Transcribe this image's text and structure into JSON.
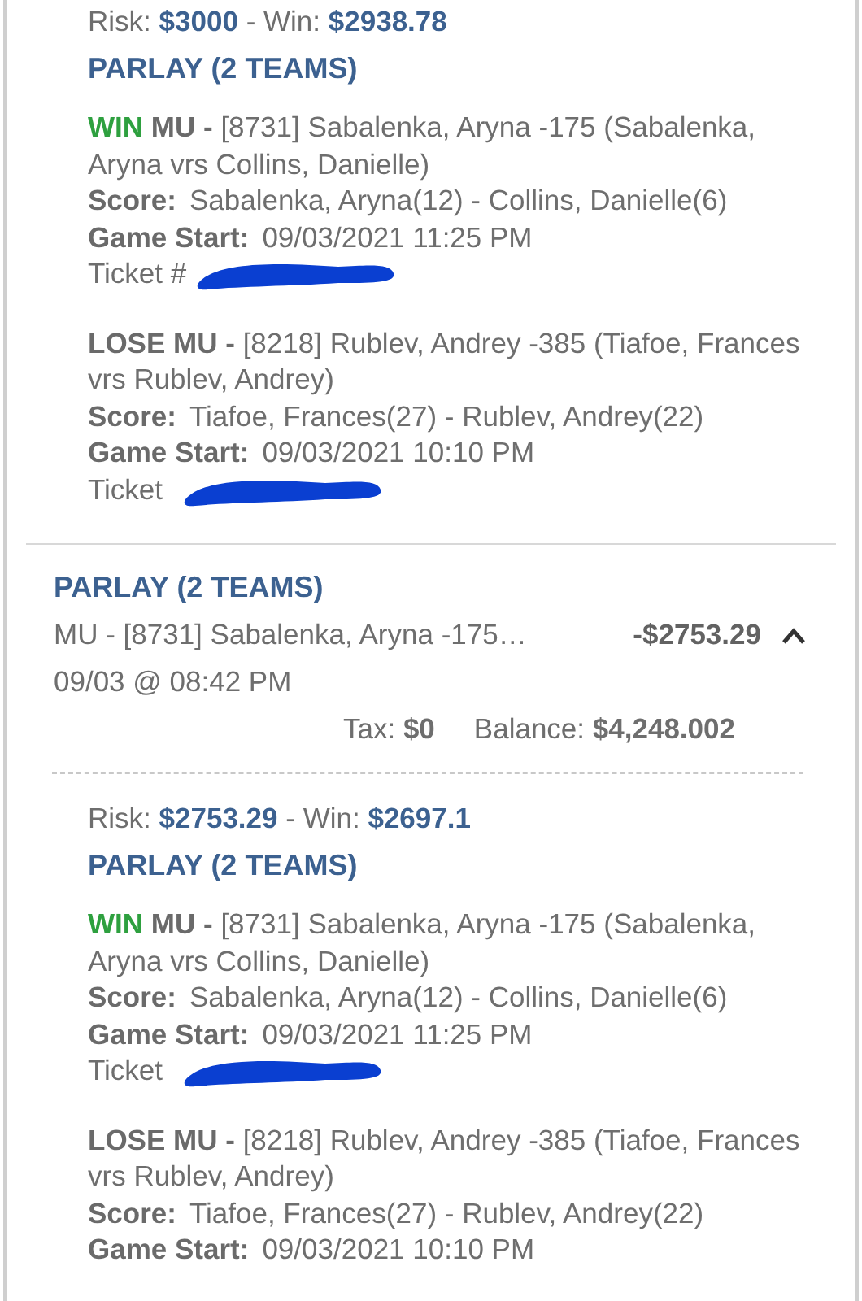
{
  "sections": [
    {
      "kind": "details",
      "risk_label": "Risk:",
      "risk": "$3000",
      "win_label": "- Win:",
      "win": "$2938.78",
      "bet_type": "PARLAY (2 TEAMS)",
      "legs": [
        {
          "kind": "win",
          "outcome": "WIN",
          "market": "MU -",
          "selection": "[8731] Sabalenka, Aryna -175 (Sabalenka, Aryna vrs Collins, Danielle)",
          "score_label": "Score:",
          "score": "Sabalenka, Aryna(12) - Collins, Danielle(6)",
          "start_label": "Game Start:",
          "start": "09/03/2021 11:25 PM",
          "ticket_label": "Ticket #"
        },
        {
          "kind": "lose",
          "outcome": "LOSE",
          "market": "MU -",
          "selection": "[8218] Rublev, Andrey -385 (Tiafoe, Frances vrs Rublev, Andrey)",
          "score_label": "Score:",
          "score": "Tiafoe, Frances(27) - Rublev, Andrey(22)",
          "start_label": "Game Start:",
          "start": "09/03/2021 10:10 PM",
          "ticket_label": "Ticket"
        }
      ]
    },
    {
      "kind": "summary",
      "bet_type": "PARLAY (2 TEAMS)",
      "selection": "MU - [8731] Sabalenka, Aryna -175…",
      "amount": "-$2753.29",
      "expanded": true,
      "placed": "09/03 @ 08:42 PM",
      "tax_label": "Tax:",
      "tax": "$0",
      "balance_label": "Balance:",
      "balance": "$4,248.002"
    },
    {
      "kind": "details",
      "risk_label": "Risk:",
      "risk": "$2753.29",
      "win_label": "- Win:",
      "win": "$2697.1",
      "bet_type": "PARLAY (2 TEAMS)",
      "legs": [
        {
          "kind": "win",
          "outcome": "WIN",
          "market": "MU -",
          "selection": "[8731] Sabalenka, Aryna -175 (Sabalenka, Aryna vrs Collins, Danielle)",
          "score_label": "Score:",
          "score": "Sabalenka, Aryna(12) - Collins, Danielle(6)",
          "start_label": "Game Start:",
          "start": "09/03/2021 11:25 PM",
          "ticket_label": "Ticket"
        },
        {
          "kind": "lose",
          "outcome": "LOSE",
          "market": "MU -",
          "selection": "[8218] Rublev, Andrey -385 (Tiafoe, Frances vrs Rublev, Andrey)",
          "score_label": "Score:",
          "score": "Tiafoe, Frances(27) - Rublev, Andrey(22)",
          "start_label": "Game Start:",
          "start": "09/03/2021 10:10 PM"
        }
      ]
    }
  ]
}
